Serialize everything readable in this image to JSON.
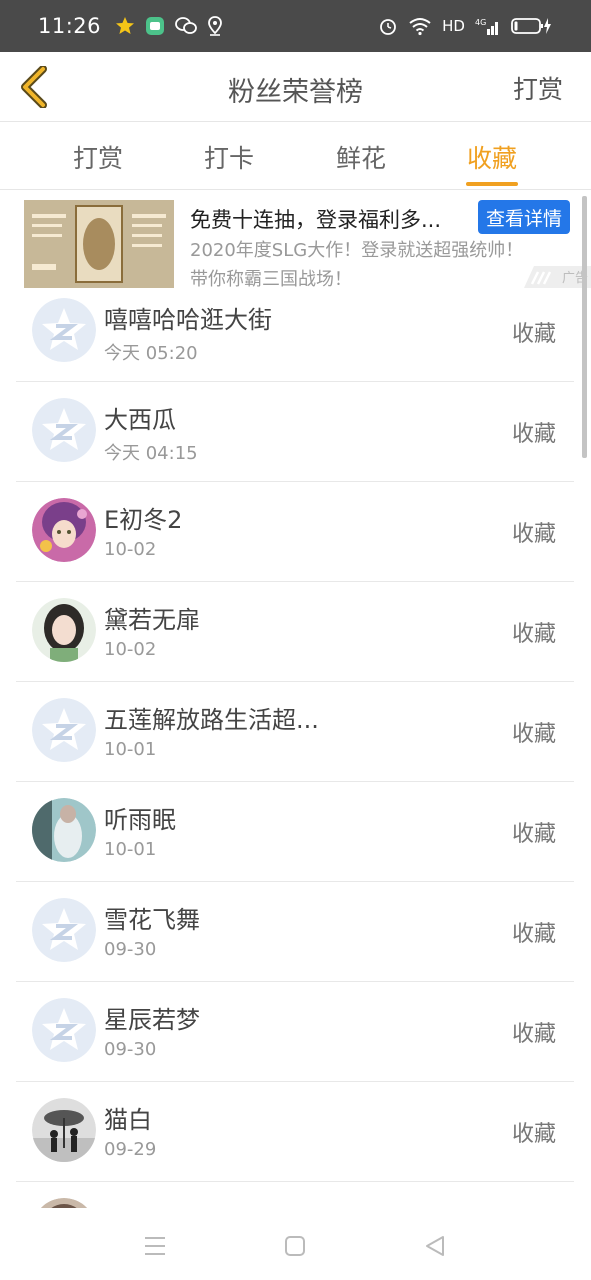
{
  "status_bar": {
    "time": "11:26",
    "network": "HD",
    "signal": "4G"
  },
  "header": {
    "title": "粉丝荣誉榜",
    "action": "打赏"
  },
  "tabs": [
    {
      "label": "打赏",
      "active": false
    },
    {
      "label": "打卡",
      "active": false
    },
    {
      "label": "鲜花",
      "active": false
    },
    {
      "label": "收藏",
      "active": true
    }
  ],
  "ad": {
    "title": "免费十连抽，登录福利多...",
    "button": "查看详情",
    "desc_line1": "2020年度SLG大作！登录就送超强统帅！",
    "desc_line2": "带你称霸三国战场！",
    "tag": "广告"
  },
  "list": [
    {
      "name": "嘻嘻哈哈逛大街",
      "time": "今天 05:20",
      "action": "收藏",
      "avatar": "default"
    },
    {
      "name": "大西瓜",
      "time": "今天 04:15",
      "action": "收藏",
      "avatar": "default"
    },
    {
      "name": "E初冬2",
      "time": "10-02",
      "action": "收藏",
      "avatar": "anime"
    },
    {
      "name": "黛若无扉",
      "time": "10-02",
      "action": "收藏",
      "avatar": "girl"
    },
    {
      "name": "五莲解放路生活超...",
      "time": "10-01",
      "action": "收藏",
      "avatar": "default"
    },
    {
      "name": "听雨眠",
      "time": "10-01",
      "action": "收藏",
      "avatar": "photo"
    },
    {
      "name": "雪花飞舞",
      "time": "09-30",
      "action": "收藏",
      "avatar": "default"
    },
    {
      "name": "星辰若梦",
      "time": "09-30",
      "action": "收藏",
      "avatar": "default"
    },
    {
      "name": "猫白",
      "time": "09-29",
      "action": "收藏",
      "avatar": "bw"
    }
  ],
  "colors": {
    "accent": "#f0a020",
    "ad_button": "#2477e8",
    "status_bar": "#4a4a4a"
  }
}
